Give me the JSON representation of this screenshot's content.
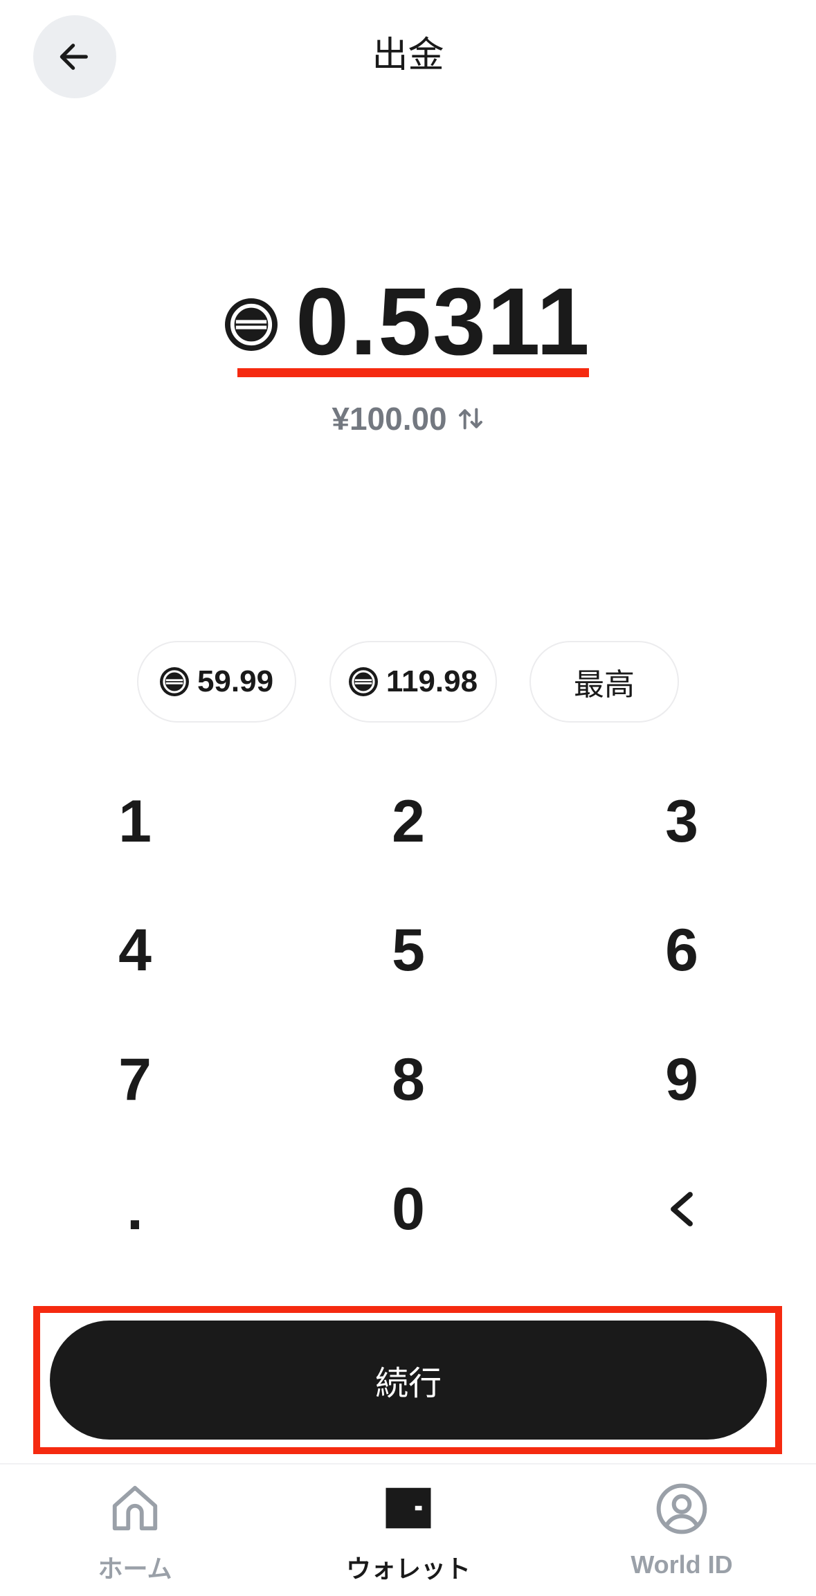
{
  "header": {
    "title": "出金",
    "back_icon": "arrow-left-icon"
  },
  "amount": {
    "coin_icon": "worldcoin-icon",
    "value": "0.5311",
    "fiat": "¥100.00",
    "swap_icon": "swap-vertical-icon"
  },
  "presets": [
    {
      "label": "59.99",
      "icon": "worldcoin-icon"
    },
    {
      "label": "119.98",
      "icon": "worldcoin-icon"
    },
    {
      "label": "最高"
    }
  ],
  "keypad": {
    "keys": [
      "1",
      "2",
      "3",
      "4",
      "5",
      "6",
      "7",
      "8",
      "9",
      ".",
      "0",
      "<"
    ]
  },
  "continue_label": "続行",
  "nav": {
    "items": [
      {
        "label": "ホーム",
        "icon": "home-icon",
        "active": false
      },
      {
        "label": "ウォレット",
        "icon": "wallet-icon",
        "active": true
      },
      {
        "label": "World ID",
        "icon": "user-circle-icon",
        "active": false
      }
    ]
  },
  "colors": {
    "primary": "#1a1a1a",
    "highlight": "#f52a10",
    "muted": "#9aa0a8",
    "chip_border": "#ececee",
    "back_bg": "#eceef1"
  }
}
